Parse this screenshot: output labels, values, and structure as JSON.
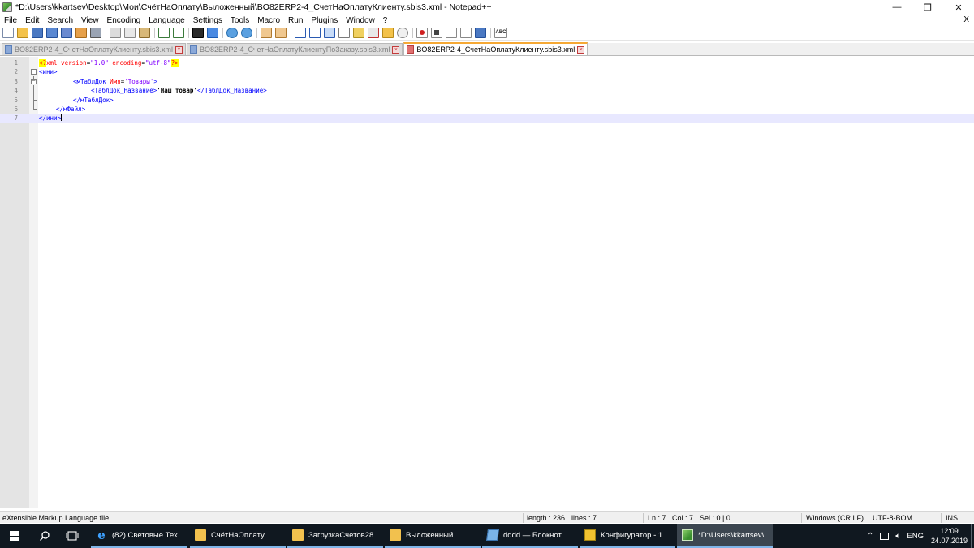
{
  "window": {
    "title": "*D:\\Users\\kkartsev\\Desktop\\Мои\\СчётНаОплату\\Выложенный\\BO82ERP2-4_СчетНаОплатуКлиенту.sbis3.xml - Notepad++",
    "minimize": "—",
    "maximize": "❐",
    "close": "✕"
  },
  "menu": {
    "items": [
      "File",
      "Edit",
      "Search",
      "View",
      "Encoding",
      "Language",
      "Settings",
      "Tools",
      "Macro",
      "Run",
      "Plugins",
      "Window",
      "?"
    ],
    "close_doc": "X"
  },
  "toolbar": {
    "icons": [
      "new-file-icon",
      "open-file-icon",
      "save-icon",
      "save-all-icon",
      "close-icon",
      "close-all-icon",
      "print-icon",
      "cut-icon",
      "copy-icon",
      "paste-icon",
      "undo-icon",
      "redo-icon",
      "find-icon",
      "replace-icon",
      "zoom-in-icon",
      "zoom-out-icon",
      "sync-vertical-icon",
      "sync-horizontal-icon",
      "word-wrap-icon",
      "show-all-chars-icon",
      "indent-guide-icon",
      "lang-define-icon",
      "doc-map-icon",
      "function-list-icon",
      "folder-workspace-icon",
      "monitoring-icon",
      "record-macro-icon",
      "stop-record-icon",
      "play-macro-icon",
      "run-macro-multiple-icon",
      "save-macro-icon",
      "spell-check-icon"
    ],
    "spell_label": "ABC"
  },
  "tabs": [
    {
      "label": "BO82ERP2-4_СчетНаОплатуКлиенту.sbis3.xml",
      "active": false
    },
    {
      "label": "BO82ERP2-4_СчетНаОплатуКлиентуПоЗаказу.sbis3.xml",
      "active": false
    },
    {
      "label": "BO82ERP2-4_СчетНаОплатуКлиенту.sbis3.xml",
      "active": true
    }
  ],
  "editor": {
    "lines": [
      {
        "n": "1"
      },
      {
        "n": "2"
      },
      {
        "n": "3"
      },
      {
        "n": "4"
      },
      {
        "n": "5"
      },
      {
        "n": "6"
      },
      {
        "n": "7"
      }
    ],
    "tokens": {
      "l1_open": "<?",
      "l1_xml": "xml ",
      "l1_attr1": "version",
      "l1_eq1": "=",
      "l1_val1": "\"1.0\"",
      "l1_attr2": " encoding",
      "l1_eq2": "=",
      "l1_val2": "\"utf-8\"",
      "l1_close": "?>",
      "l2_tag": "<ини>",
      "l3_open": "<мТаблДок ",
      "l3_attr": "Имя",
      "l3_eq": "=",
      "l3_val": "'Товары'",
      "l3_close": ">",
      "l4_open": "<ТаблДок_Название>",
      "l4_text": "'Наш товар'",
      "l4_close": "</ТаблДок_Название>",
      "l5_tag": "</мТаблДок>",
      "l6_tag": "</мФайл>",
      "l7_tag": "</ини>"
    }
  },
  "status": {
    "filetype": "eXtensible Markup Language file",
    "length": "length : 236",
    "lines": "lines : 7",
    "ln": "Ln : 7",
    "col": "Col : 7",
    "sel": "Sel : 0 | 0",
    "eol": "Windows (CR LF)",
    "encoding": "UTF-8-BOM",
    "mode": "INS"
  },
  "taskbar": {
    "tasks": [
      {
        "label": "(82) Световые Тех...",
        "icon": "ie-icon"
      },
      {
        "label": "СчётНаОплату",
        "icon": "folder-icon"
      },
      {
        "label": "ЗагрузкаСчетов28",
        "icon": "folder-icon"
      },
      {
        "label": "Выложенный",
        "icon": "folder-icon"
      },
      {
        "label": "dddd — Блокнот",
        "icon": "notepad-icon"
      },
      {
        "label": "Конфигуратор - 1...",
        "icon": "1c-icon"
      },
      {
        "label": "*D:\\Users\\kkartsev\\...",
        "icon": "notepadpp-icon"
      }
    ],
    "tray": {
      "lang": "ENG",
      "time": "12:09",
      "date": "24.07.2019"
    }
  }
}
